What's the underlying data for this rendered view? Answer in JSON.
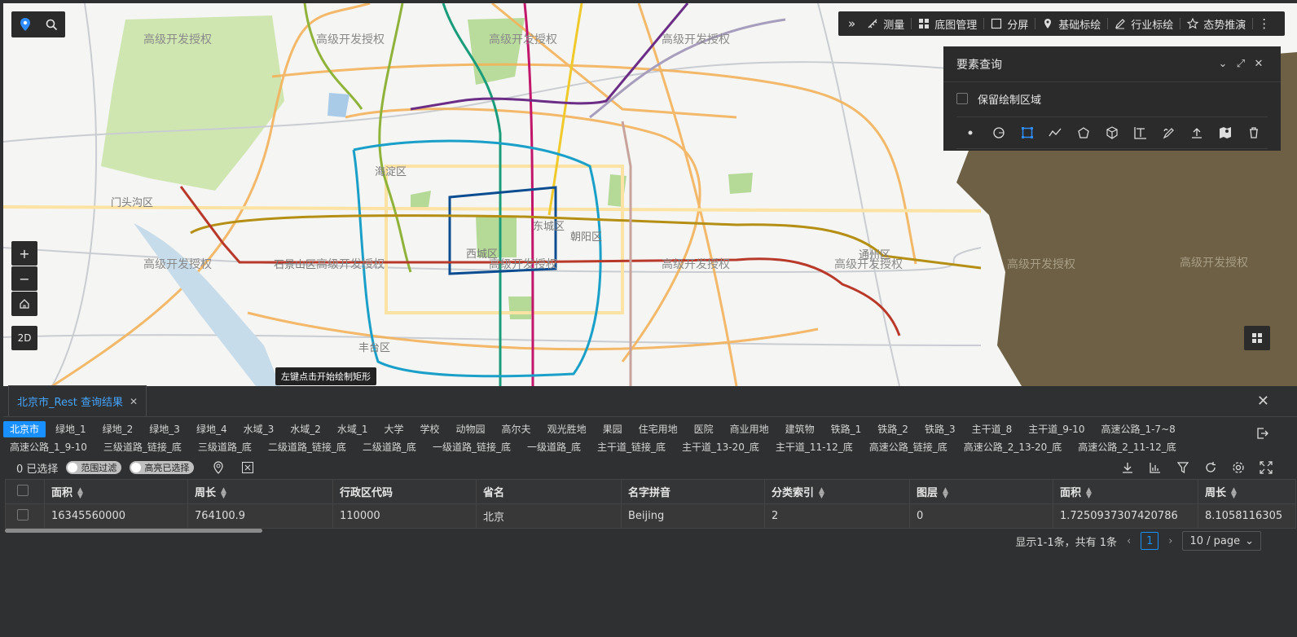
{
  "map": {
    "watermark": "高级开发授权",
    "districts": {
      "haidian": "海淀区",
      "mentougou": "门头沟区",
      "shijingshan": "石景山区",
      "xicheng": "西城区",
      "dongcheng": "东城区",
      "chaoyang": "朝阳区",
      "fengtai": "丰台区",
      "tongzhou": "通州区"
    },
    "hint": "左键点击开始绘制矩形",
    "zoom_in": "+",
    "zoom_out": "−",
    "mode_2d": "2D"
  },
  "toolbar": {
    "expand": "»",
    "measure": "测量",
    "basemap": "底图管理",
    "split": "分屏",
    "basic_mark": "基础标绘",
    "industry_mark": "行业标绘",
    "situation": "态势推演",
    "more": "⋮"
  },
  "query_panel": {
    "title": "要素查询",
    "keep_area_label": "保留绘制区域",
    "tools": [
      "point-icon",
      "circle-icon",
      "rectangle-icon",
      "polyline-icon",
      "polygon-icon",
      "cube-icon",
      "text-icon",
      "freehand-icon",
      "upload-icon",
      "map-pin-icon",
      "trash-icon"
    ]
  },
  "result": {
    "tab_title": "北京市_Rest 查询结果",
    "layers_row1": [
      "北京市",
      "绿地_1",
      "绿地_2",
      "绿地_3",
      "绿地_4",
      "水域_3",
      "水域_2",
      "水域_1",
      "大学",
      "学校",
      "动物园",
      "高尔夫",
      "观光胜地",
      "果园",
      "住宅用地",
      "医院",
      "商业用地",
      "建筑物",
      "铁路_1",
      "铁路_2",
      "铁路_3",
      "主干道_8",
      "主干道_9-10",
      "高速公路_1-7~8"
    ],
    "layers_row2": [
      "高速公路_1_9-10",
      "三级道路_链接_底",
      "三级道路_底",
      "二级道路_链接_底",
      "二级道路_底",
      "一级道路_链接_底",
      "一级道路_底",
      "主干道_链接_底",
      "主干道_13-20_底",
      "主干道_11-12_底",
      "高速公路_链接_底",
      "高速公路_2_13-20_底",
      "高速公路_2_11-12_底"
    ],
    "selected_text": "0 已选择",
    "filter_switch": "范围过滤",
    "highlight_switch": "高亮已选择",
    "columns": [
      "面积",
      "周长",
      "行政区代码",
      "省名",
      "名字拼音",
      "分类索引",
      "图层",
      "面积",
      "周长"
    ],
    "sortable": [
      true,
      true,
      false,
      false,
      false,
      true,
      true,
      true,
      true
    ],
    "rows": [
      [
        "16345560000",
        "764100.9",
        "110000",
        "北京",
        "Beijing",
        "2",
        "0",
        "1.7250937307420786",
        "8.1058116305"
      ]
    ],
    "pager": {
      "summary": "显示1-1条，共有 1条",
      "current": "1",
      "page_size": "10 / page"
    }
  }
}
